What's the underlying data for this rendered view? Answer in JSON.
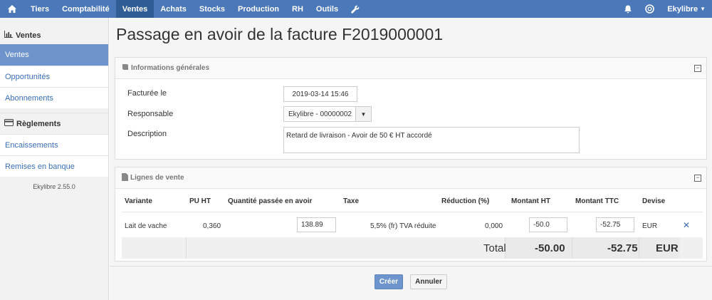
{
  "navbar": {
    "home_icon": "home-icon",
    "items": [
      {
        "label": "Tiers"
      },
      {
        "label": "Comptabilité"
      },
      {
        "label": "Ventes",
        "active": true
      },
      {
        "label": "Achats"
      },
      {
        "label": "Stocks"
      },
      {
        "label": "Production"
      },
      {
        "label": "RH"
      },
      {
        "label": "Outils"
      }
    ],
    "wrench_icon": "wrench-icon",
    "bell_icon": "bell-icon",
    "help_icon": "help-icon",
    "user_label": "Ekylibre",
    "accent": "#4a78b8"
  },
  "sidebar": {
    "sections": [
      {
        "title": "Ventes",
        "icon": "bar-chart-icon",
        "items": [
          {
            "label": "Ventes",
            "active": true
          },
          {
            "label": "Opportunités"
          },
          {
            "label": "Abonnements"
          }
        ]
      },
      {
        "title": "Règlements",
        "icon": "credit-card-icon",
        "items": [
          {
            "label": "Encaissements"
          },
          {
            "label": "Remises en banque"
          }
        ]
      }
    ],
    "version": "Ekylibre 2.55.0"
  },
  "page": {
    "title": "Passage en avoir de la facture F2019000001"
  },
  "general_panel": {
    "title": "Informations générales",
    "icon": "book-icon",
    "invoiced_label": "Facturée le",
    "invoiced_value": "2019-03-14 15:46",
    "responsible_label": "Responsable",
    "responsible_value": "Ekylibre - 00000002",
    "description_label": "Description",
    "description_value": "Retard de livraison - Avoir de 50 € HT accordé"
  },
  "lines_panel": {
    "title": "Lignes de vente",
    "icon": "file-icon",
    "headers": {
      "variant": "Variante",
      "unit_price": "PU HT",
      "quantity": "Quantité passée en avoir",
      "tax": "Taxe",
      "reduction": "Réduction (%)",
      "amount_ht": "Montant HT",
      "amount_ttc": "Montant TTC",
      "currency": "Devise"
    },
    "rows": [
      {
        "variant": "Lait de vache",
        "unit_price": "0,360",
        "quantity": "138.89",
        "tax": "5,5% (fr) TVA réduite",
        "reduction": "0,000",
        "amount_ht": "-50.0",
        "amount_ttc": "-52.75",
        "currency": "EUR"
      }
    ],
    "total": {
      "label": "Total",
      "amount_ht": "-50.00",
      "amount_ttc": "-52.75",
      "currency": "EUR"
    }
  },
  "actions": {
    "create_label": "Créer",
    "cancel_label": "Annuler"
  }
}
